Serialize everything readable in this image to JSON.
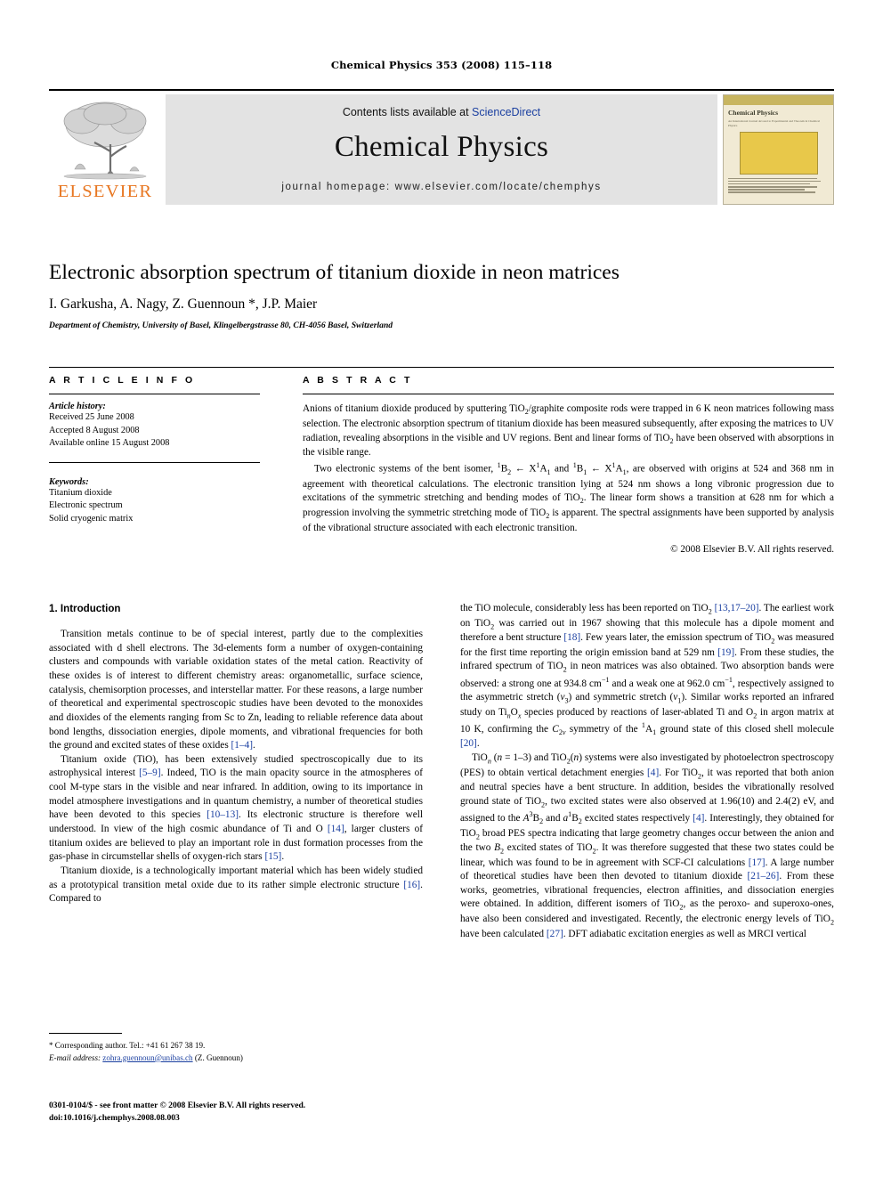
{
  "running_head": "Chemical Physics 353 (2008) 115–118",
  "masthead": {
    "contents_prefix": "Contents lists available at ",
    "sciencedirect": "ScienceDirect",
    "journal_name": "Chemical Physics",
    "homepage": "journal homepage: www.elsevier.com/locate/chemphys",
    "publisher_logo_text": "ELSEVIER",
    "cover_title": "Chemical Physics",
    "cover_subtitle": "An International Journal devoted to Experimental and Theoretical Chemical Physics"
  },
  "article": {
    "title": "Electronic absorption spectrum of titanium dioxide in neon matrices",
    "authors": "I. Garkusha, A. Nagy, Z. Guennoun *, J.P. Maier",
    "affiliation": "Department of Chemistry, University of Basel, Klingelbergstrasse 80, CH-4056 Basel, Switzerland"
  },
  "article_info": {
    "heading": "A R T I C L E   I N F O",
    "history_title": "Article history:",
    "history": [
      "Received 25 June 2008",
      "Accepted 8 August 2008",
      "Available online 15 August 2008"
    ],
    "keywords_title": "Keywords:",
    "keywords": [
      "Titanium dioxide",
      "Electronic spectrum",
      "Solid cryogenic matrix"
    ]
  },
  "abstract": {
    "heading": "A B S T R A C T",
    "paragraph1_html": "Anions of titanium dioxide produced by sputtering TiO<sub>2</sub>/graphite composite rods were trapped in 6 K neon matrices following mass selection. The electronic absorption spectrum of titanium dioxide has been measured subsequently, after exposing the matrices to UV radiation, revealing absorptions in the visible and UV regions. Bent and linear forms of TiO<sub>2</sub> have been observed with absorptions in the visible range.",
    "paragraph2_html": "Two electronic systems of the bent isomer, <sup>1</sup>B<sub>2</sub> ← X<sup>1</sup>A<sub>1</sub> and <sup>1</sup>B<sub>1</sub> ← X<sup>1</sup>A<sub>1</sub>, are observed with origins at 524 and 368 nm in agreement with theoretical calculations. The electronic transition lying at 524 nm shows a long vibronic progression due to excitations of the symmetric stretching and bending modes of TiO<sub>2</sub>. The linear form shows a transition at 628 nm for which a progression involving the symmetric stretching mode of TiO<sub>2</sub> is apparent. The spectral assignments have been supported by analysis of the vibrational structure associated with each electronic transition.",
    "copyright": "© 2008 Elsevier B.V. All rights reserved."
  },
  "body": {
    "section_heading": "1. Introduction",
    "left_column": [
      "Transition metals continue to be of special interest, partly due to the complexities associated with d shell electrons. The 3d-elements form a number of oxygen-containing clusters and compounds with variable oxidation states of the metal cation. Reactivity of these oxides is of interest to different chemistry areas: organometallic, surface science, catalysis, chemisorption processes, and interstellar matter. For these reasons, a large number of theoretical and experimental spectroscopic studies have been devoted to the monoxides and dioxides of the elements ranging from Sc to Zn, leading to reliable reference data about bond lengths, dissociation energies, dipole moments, and vibrational frequencies for both the ground and excited states of these oxides <span class=\"ref\">[1–4]</span>.",
      "Titanium oxide (TiO), has been extensively studied spectroscopically due to its astrophysical interest <span class=\"ref\">[5–9]</span>. Indeed, TiO is the main opacity source in the atmospheres of cool M-type stars in the visible and near infrared. In addition, owing to its importance in model atmosphere investigations and in quantum chemistry, a number of theoretical studies have been devoted to this species <span class=\"ref\">[10–13]</span>. Its electronic structure is therefore well understood. In view of the high cosmic abundance of Ti and O <span class=\"ref\">[14]</span>, larger clusters of titanium oxides are believed to play an important role in dust formation processes from the gas-phase in circumstellar shells of oxygen-rich stars <span class=\"ref\">[15]</span>.",
      "Titanium dioxide, is a technologically important material which has been widely studied as a prototypical transition metal oxide due to its rather simple electronic structure <span class=\"ref\">[16]</span>. Compared to"
    ],
    "right_column": [
      "the TiO molecule, considerably less has been reported on TiO<sub>2</sub> <span class=\"ref\">[13,17–20]</span>. The earliest work on TiO<sub>2</sub> was carried out in 1967 showing that this molecule has a dipole moment and therefore a bent structure <span class=\"ref\">[18]</span>. Few years later, the emission spectrum of TiO<sub>2</sub> was measured for the first time reporting the origin emission band at 529 nm <span class=\"ref\">[19]</span>. From these studies, the infrared spectrum of TiO<sub>2</sub> in neon matrices was also obtained. Two absorption bands were observed: a strong one at 934.8 cm<sup>−1</sup> and a weak one at 962.0 cm<sup>−1</sup>, respectively assigned to the asymmetric stretch (<span class=\"ital\">ν</span><sub>3</sub>) and symmetric stretch (<span class=\"ital\">ν</span><sub>1</sub>). Similar works reported an infrared study on Ti<sub><span class=\"ital\">n</span></sub>O<sub><span class=\"ital\">x</span></sub> species produced by reactions of laser-ablated Ti and O<sub>2</sub> in argon matrix at 10 K, confirming the <span class=\"ital\">C</span><sub>2<span class=\"ital\">v</span></sub> symmetry of the <sup>1</sup>A<sub>1</sub> ground state of this closed shell molecule <span class=\"ref\">[20]</span>.",
      "TiO<sub><span class=\"ital\">n</span></sub> (<span class=\"ital\">n</span> = 1–3) and TiO<sub>2</sub>(<span class=\"ital\">n</span>) systems were also investigated by photoelectron spectroscopy (PES) to obtain vertical detachment energies <span class=\"ref\">[4]</span>. For TiO<sub>2</sub>, it was reported that both anion and neutral species have a bent structure. In addition, besides the vibrationally resolved ground state of TiO<sub>2</sub>, two excited states were also observed at 1.96(10) and 2.4(2) eV, and assigned to the <span class=\"ital\">A</span><sup>3</sup>B<sub>2</sub> and <span class=\"ital\">a</span><sup>1</sup>B<sub>2</sub> excited states respectively <span class=\"ref\">[4]</span>. Interestingly, they obtained for TiO<sub>2</sub> broad PES spectra indicating that large geometry changes occur between the anion and the two <span class=\"ital\">B</span><sub>2</sub> excited states of TiO<sub>2</sub>. It was therefore suggested that these two states could be linear, which was found to be in agreement with SCF-CI calculations <span class=\"ref\">[17]</span>. A large number of theoretical studies have been then devoted to titanium dioxide <span class=\"ref\">[21–26]</span>. From these works, geometries, vibrational frequencies, electron affinities, and dissociation energies were obtained. In addition, different isomers of TiO<sub>2</sub>, as the peroxo- and superoxo-ones, have also been considered and investigated. Recently, the electronic energy levels of TiO<sub>2</sub> have been calculated <span class=\"ref\">[27]</span>. DFT adiabatic excitation energies as well as MRCI vertical"
    ]
  },
  "footnotes": {
    "corresponding": "Corresponding author. Tel.: +41 61 267 38 19.",
    "email_label": "E-mail address:",
    "email": "zohra.guennoun@unibas.ch",
    "email_person": "(Z. Guennoun)"
  },
  "footer": {
    "issn_line": "0301-0104/$ - see front matter © 2008 Elsevier B.V. All rights reserved.",
    "doi_line": "doi:10.1016/j.chemphys.2008.08.003"
  },
  "colors": {
    "link_blue": "#1a3fa0",
    "elsevier_orange": "#E87722",
    "band_gray": "#e3e3e3"
  }
}
